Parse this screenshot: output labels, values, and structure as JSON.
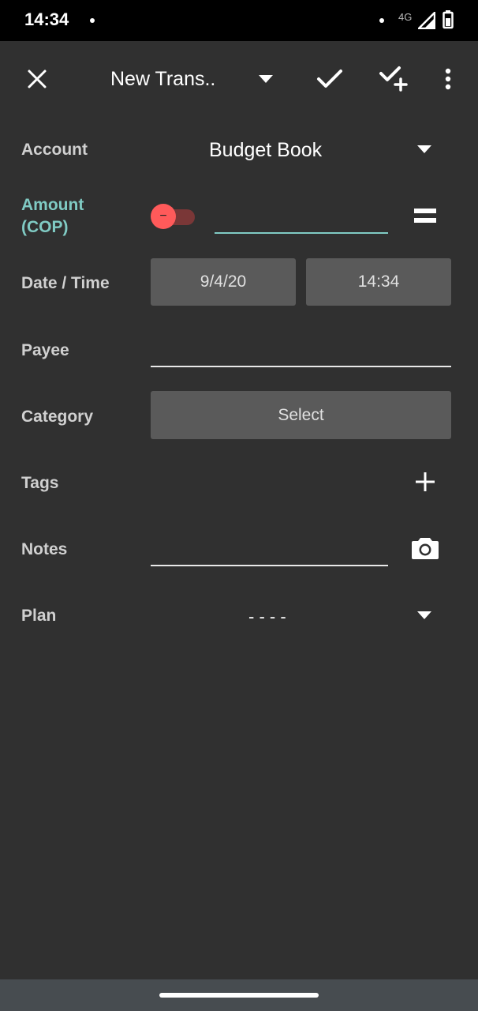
{
  "status_bar": {
    "time": "14:34",
    "network": "4G"
  },
  "toolbar": {
    "title": "New Trans.."
  },
  "form": {
    "account": {
      "label": "Account",
      "value": "Budget Book"
    },
    "amount": {
      "label_line1": "Amount",
      "label_line2": "(COP)",
      "value": "",
      "sign": "−"
    },
    "datetime": {
      "label": "Date / Time",
      "date": "9/4/20",
      "time": "14:34"
    },
    "payee": {
      "label": "Payee",
      "value": ""
    },
    "category": {
      "label": "Category",
      "button": "Select"
    },
    "tags": {
      "label": "Tags"
    },
    "notes": {
      "label": "Notes",
      "value": ""
    },
    "plan": {
      "label": "Plan",
      "value": "- - - -"
    }
  },
  "colors": {
    "accent": "#80cbc4",
    "toggle": "#ff5a5a",
    "background": "#303030"
  }
}
